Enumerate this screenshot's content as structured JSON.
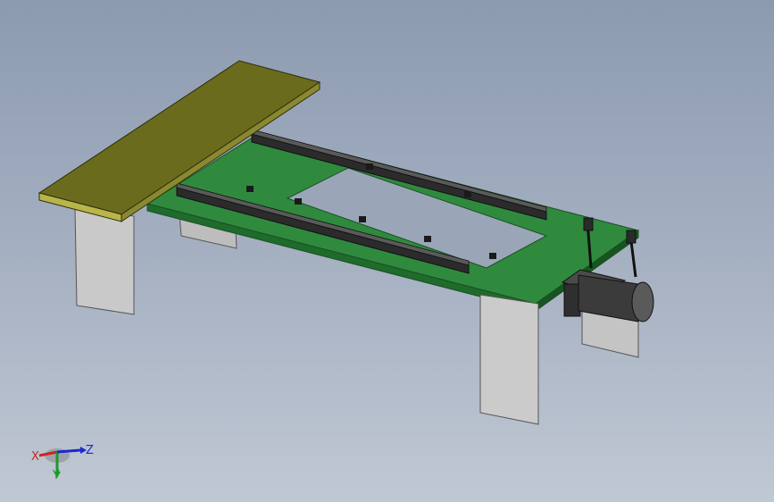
{
  "viewport": {
    "background_top": "#8c9ab0",
    "background_bottom": "#c0c8d3"
  },
  "model": {
    "colors": {
      "top_plate": "#6b6b1e",
      "base_plate": "#2e7d3a",
      "legs": "#c8c8c8",
      "rails": "#2a2a2a",
      "motor": "#3a3a3a"
    }
  },
  "triad": {
    "x_label": "X",
    "y_label": "Y",
    "z_label": "Z",
    "x_color": "#cc2222",
    "y_color": "#1a9a2a",
    "z_color": "#1a2acc"
  }
}
